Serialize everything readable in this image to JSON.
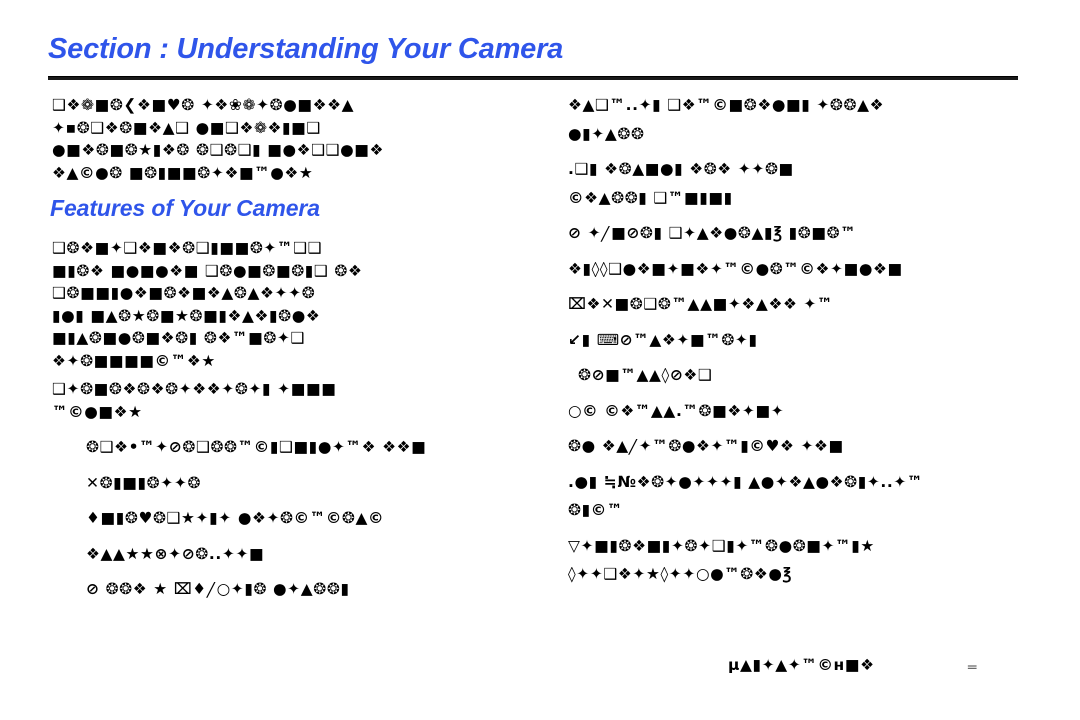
{
  "document": {
    "kind": "camera-user-manual-page",
    "title": "Section : Understanding Your Camera",
    "subtitle": "Features of Your Camera",
    "accent_color": "#2f55ea",
    "text_color": "#000000",
    "page_background": "#ffffff",
    "rule_color": "#1a1a1a",
    "page_number_color": "#6b6b6b"
  },
  "header": {
    "title": "Section : Understanding Your Camera"
  },
  "subheading": {
    "label": "Features of Your Camera"
  },
  "left_column": {
    "intro_lines": [
      "❑❖❁■❂❮❖■♥❂        ✦❖❀❁✦❂●■❖❖▲",
      "✦▪❂❑❖❂■❖▲❑        ●■❑❖❁❖▮■❑",
      "●■❖❂■❂★▮❖❂ ❂❑❂❑▮ ■●❖❑❑●■❖",
      "❖▲©●❂ ■❂▮■■❂✦❖■™●❖★"
    ],
    "body_lines": [
      "❑❂❖■✦❑❖■❖❂❑▮■■❂✦™❑❑",
      "■▮❂❖ ■●■●❖■ ❑❂●■❂■❂▮❑ ❂❖",
      "❑❂■■▮●❖■❂❖■❖▲❂▲❖✦✦❂",
      "▮●▮ ■▲❂★❂■★❂■▮❖▲❖▮❂●❖",
      "■▮▲❂■●❂■❖❂▮ ❂❖™■❂✦❑",
      "❖✦❂■■■■©™❖★",
      "❑✦❂■❂❖❂❖❂✦❖❖✦❂✦▮ ✦■■■",
      "™©●■❖★"
    ],
    "bullet_lines": [
      "❂❑❖•™✦⊘❂❑❂❂™©▮❑■▮●✦™❖ ❖❖■",
      "✕❂▮■▮❂✦✦❂",
      "♦■▮❂♥❂❑★✦▮✦ ●❖✦❂©™©❂▲©",
      "❖▲▲★★⊗✦⊘❂..✦✦■",
      "⊘ ❂❂❖ ★ ⌧♦╱○✦▮❂ ●✦▲❂❂▮"
    ]
  },
  "right_column": {
    "lines": [
      "❖▲❑™..✦▮ ❑❖™©■❂❖●■▮ ✦❂❂▲❖",
      "●▮✦▲❂❂",
      ".❑▮ ❖❂▲■●▮ ❖❂❖ ✦✦❂■",
      "©❖▲❂❂▮ ❑™■▮■▮",
      "⊘ ✦╱■⊘❂▮ ❑✦▲❖●❂▲▮℥        ▮❂■❂™",
      "❖▮◊◊❑●❖■✦■❖✦™©●❂™©❖✦■●❖■",
      "⌧❖✕■❂❑❂™▲▲■✦❖▲❖❖ ✦™",
      "↙▮ ⌨⊘™▲❖✦■™❂✦▮",
      "❂⊘■™▲▲◊⊘❖❑",
      "○© ©❖™▲▲.™❂■❖✦■✦",
      "❂● ❖▲╱✦™❂●❖✦™▮©♥❖ ✦❖■",
      ".●▮ ≒№❖❂✦●✦✦✦▮ ▲●✦❖▲●❖❂▮✦..✦™",
      "❂▮©™",
      "▽✦■▮❂❖■▮✦❂✦❑▮✦™❂●❂■✦™▮★",
      "◊✦✦❑❖✦★◊✦✦○●™❂❖●℥"
    ]
  },
  "footer": {
    "text": "µ▲▮✦▲✦™©ʜ■❖",
    "page_number": "═"
  }
}
